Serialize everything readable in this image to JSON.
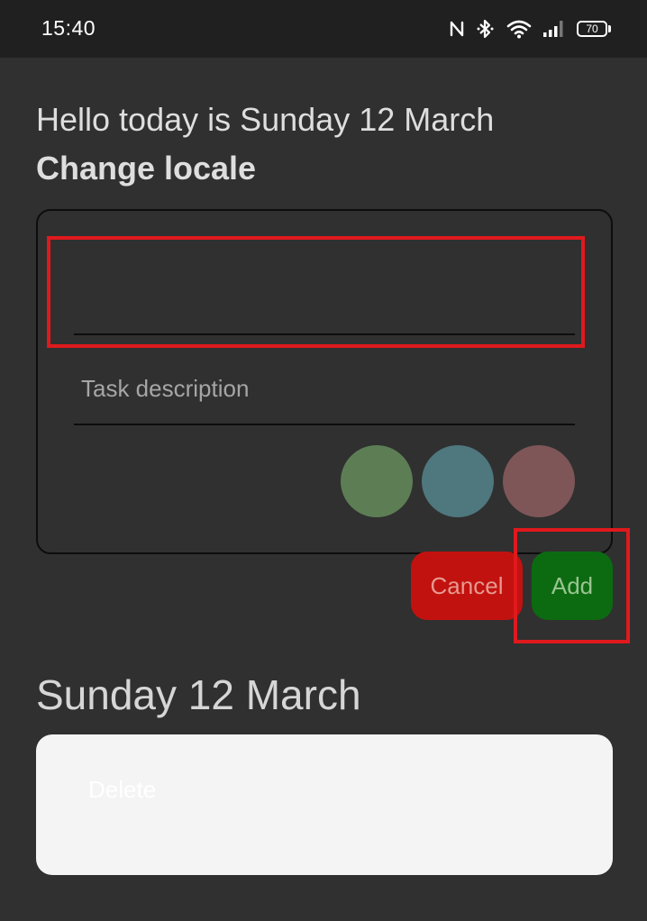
{
  "status_bar": {
    "time": "15:40",
    "battery": "70",
    "icons": [
      "nfc-icon",
      "bluetooth-icon",
      "wifi-icon",
      "signal-icon",
      "battery-icon"
    ]
  },
  "header": {
    "greeting": "Hello today is Sunday 12 March",
    "change_locale": "Change locale"
  },
  "form": {
    "title_value": "",
    "description_placeholder": "Task description",
    "colors": [
      "#5d7e55",
      "#4f777e",
      "#7e5657"
    ],
    "cancel_label": "Cancel",
    "add_label": "Add",
    "highlight_color": "#e0191d"
  },
  "tasks": {
    "date_heading": "Sunday 12 March",
    "items": [
      {
        "delete_label": "Delete"
      }
    ]
  }
}
